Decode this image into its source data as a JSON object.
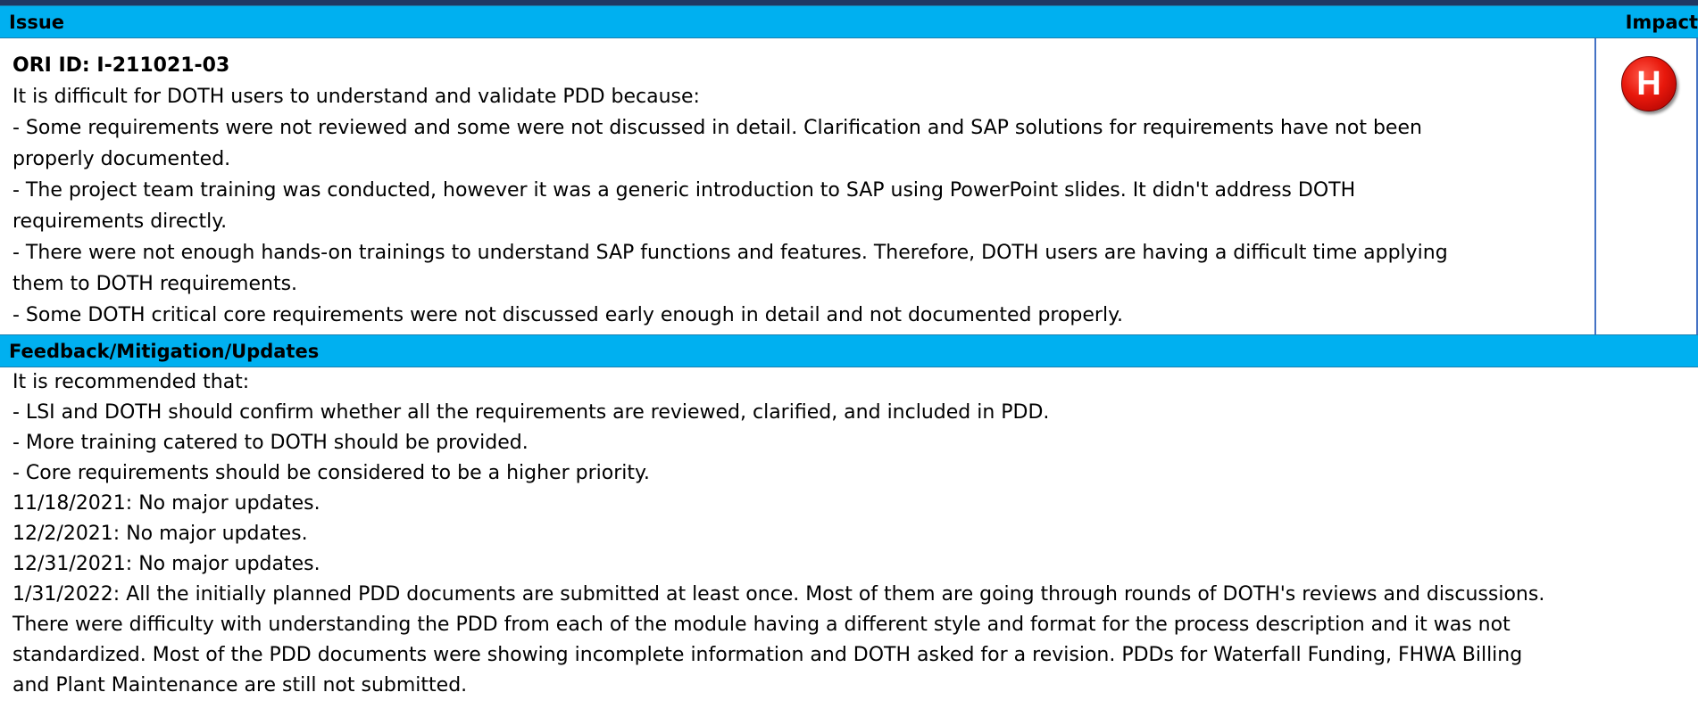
{
  "issue_header": {
    "left": "Issue",
    "right": "Impact"
  },
  "impact": {
    "level": "H",
    "color": "#e8180c"
  },
  "issue": {
    "id": "ORI ID: I-211021-03",
    "lines": [
      "It is difficult for DOTH users to understand and validate PDD because:",
      "- Some requirements were not reviewed and some were not discussed in detail. Clarification and SAP solutions for requirements have not been",
      "properly documented.",
      "- The project team training was conducted, however it was a generic introduction to SAP using PowerPoint slides. It didn't address DOTH",
      "requirements directly.",
      "- There were not enough hands-on trainings to understand SAP functions and features. Therefore, DOTH users are having a difficult time applying",
      "them to DOTH requirements.",
      "- Some DOTH critical core requirements were not discussed early enough in detail and not documented properly."
    ]
  },
  "feedback_header": {
    "title": "Feedback/Mitigation/Updates"
  },
  "feedback": {
    "lines": [
      "It is recommended that:",
      "- LSI and DOTH should confirm whether all the requirements are reviewed, clarified, and included in PDD.",
      "- More training catered to DOTH should be provided.",
      "- Core requirements should be considered to be a higher priority.",
      "11/18/2021: No major updates.",
      "12/2/2021: No major updates.",
      "12/31/2021: No major updates.",
      "1/31/2022: All the initially planned PDD documents are submitted at least once.  Most of them are going through rounds of DOTH's reviews and discussions.",
      "There were difficulty with understanding the PDD from each of the module having a different style and format for the process description and it was not",
      "standardized. Most of the PDD documents were showing incomplete information and DOTH asked for a revision. PDDs for Waterfall Funding, FHWA Billing",
      "and Plant Maintenance are still not submitted."
    ]
  },
  "colors": {
    "header_bg": "#00b0f0",
    "topbar": "#1f3864",
    "divider": "#4472c4"
  }
}
